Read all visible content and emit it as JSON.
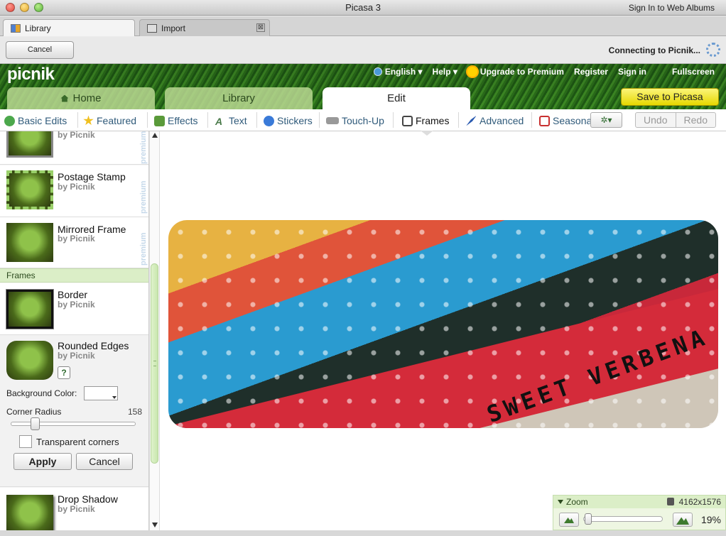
{
  "window": {
    "title": "Picasa 3",
    "sign_in": "Sign In to Web Albums"
  },
  "tabs": [
    {
      "label": "Library",
      "icon": "library-grid-icon"
    },
    {
      "label": "Import",
      "icon": "import-icon",
      "close": "⊠"
    }
  ],
  "toolbar": {
    "cancel_label": "Cancel",
    "status": "Connecting to Picnik..."
  },
  "picnik": {
    "logo": "picnik",
    "topnav": {
      "language": "English ▾",
      "help": "Help ▾",
      "upgrade": "Upgrade to Premium",
      "register": "Register",
      "signin": "Sign in",
      "fullscreen": "Fullscreen"
    },
    "nav": {
      "home": "Home",
      "library": "Library",
      "edit": "Edit"
    },
    "save_label": "Save to Picasa"
  },
  "edit_tools": [
    {
      "label": "Basic Edits",
      "icon": "basic-edits-icon",
      "color": "#4ca84c"
    },
    {
      "label": "Featured",
      "icon": "star-icon",
      "color": "#f0c020"
    },
    {
      "label": "Effects",
      "icon": "effects-icon",
      "color": "#5a9a3a"
    },
    {
      "label": "Text",
      "icon": "text-icon",
      "color": "#4a7a4a"
    },
    {
      "label": "Stickers",
      "icon": "stickers-icon",
      "color": "#3a7ad8"
    },
    {
      "label": "Touch-Up",
      "icon": "touch-up-icon",
      "color": "#888888"
    },
    {
      "label": "Frames",
      "icon": "frames-icon",
      "color": "#444444"
    },
    {
      "label": "Advanced",
      "icon": "advanced-icon",
      "color": "#2a5ab0"
    },
    {
      "label": "Seasonal",
      "icon": "seasonal-icon",
      "color": "#c83030"
    }
  ],
  "edit_actions": {
    "gear": "✲▾",
    "undo": "Undo",
    "redo": "Redo"
  },
  "sidebar": {
    "top_item": {
      "by": "by Picnik",
      "premium": "premium"
    },
    "postage": {
      "title": "Postage Stamp",
      "by": "by Picnik",
      "premium": "premium"
    },
    "mirrored": {
      "title": "Mirrored Frame",
      "by": "by Picnik",
      "premium": "premium"
    },
    "section": "Frames",
    "border": {
      "title": "Border",
      "by": "by Picnik"
    },
    "rounded": {
      "title": "Rounded Edges",
      "by": "by Picnik",
      "help": "?",
      "bg_label": "Background Color:",
      "cr_label": "Corner Radius",
      "cr_value": "158",
      "transparent_label": "Transparent corners",
      "apply": "Apply",
      "cancel": "Cancel"
    },
    "drop": {
      "title": "Drop Shadow",
      "by": "by Picnik"
    }
  },
  "photo": {
    "text": "SWEET VERBENA"
  },
  "zoom": {
    "title": "Zoom",
    "dimensions": "4162x1576",
    "percent": "19%"
  }
}
